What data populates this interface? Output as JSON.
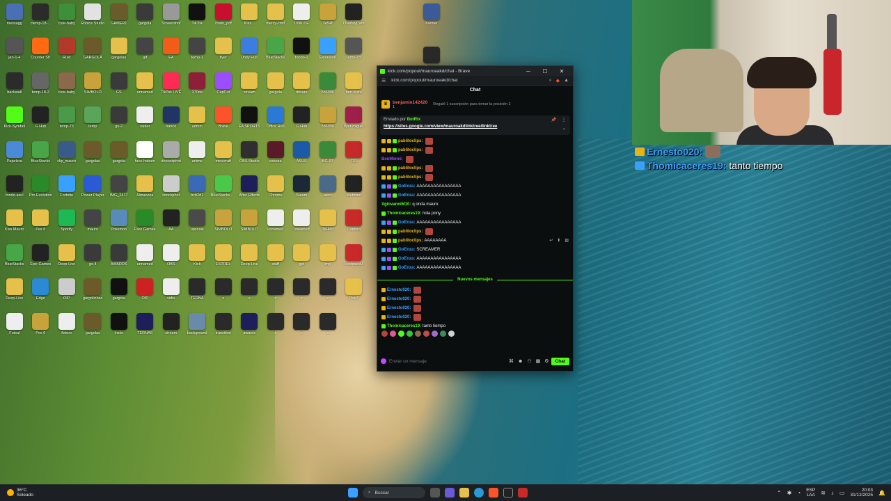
{
  "desktop": {
    "icons": [
      {
        "label": "messagg",
        "color": "#4a6fb5"
      },
      {
        "label": "ctemp-18-...",
        "color": "#2b2b2b"
      },
      {
        "label": "cute-baby",
        "color": "#3e8f3a"
      },
      {
        "label": "Roblox Studio",
        "color": "#e2e2e2"
      },
      {
        "label": "GAMER1",
        "color": "#6b5a2a"
      },
      {
        "label": "gargola",
        "color": "#3a3a3a"
      },
      {
        "label": "Screenshot",
        "color": "#999999"
      },
      {
        "label": "TikTok",
        "color": "#111111"
      },
      {
        "label": "chato_pdf",
        "color": "#c8102e"
      },
      {
        "label": "Kiss...",
        "color": "#e5c04a"
      },
      {
        "label": "mercy-cmd",
        "color": "#e5c04a"
      },
      {
        "label": "LINK DE",
        "color": "#eeeeee"
      },
      {
        "label": "2e54f",
        "color": "#c8a23a"
      },
      {
        "label": "OverlayCam",
        "color": "#222222"
      },
      {
        "label": "jan-1-4",
        "color": "#555555"
      },
      {
        "label": "Counter Str",
        "color": "#ff6a13"
      },
      {
        "label": "Rust",
        "color": "#b33a2a"
      },
      {
        "label": "GARGOLA",
        "color": "#6b5a2a"
      },
      {
        "label": "gargolas",
        "color": "#e5c04a"
      },
      {
        "label": "gif",
        "color": "#444444"
      },
      {
        "label": "EA",
        "color": "#f25c19"
      },
      {
        "label": "temp-1",
        "color": "#444444"
      },
      {
        "label": "flyer",
        "color": "#e5c04a"
      },
      {
        "label": "Unity Hub",
        "color": "#3b7de0"
      },
      {
        "label": "BlueStacks",
        "color": "#48a548"
      },
      {
        "label": "fondo-1",
        "color": "#111111"
      },
      {
        "label": "Extension",
        "color": "#3aa0ff"
      },
      {
        "label": "temp-18",
        "color": "#555555"
      },
      {
        "label": "backwall",
        "color": "#2b2b2b"
      },
      {
        "label": "temp-18-2",
        "color": "#666666"
      },
      {
        "label": "cute-baby",
        "color": "#8a6a4a"
      },
      {
        "label": "SIMBOLO",
        "color": "#c8a23a"
      },
      {
        "label": "GS",
        "color": "#3a3a3a"
      },
      {
        "label": "unnamed",
        "color": "#e5c04a"
      },
      {
        "label": "TikTok LIVE",
        "color": "#fe2c55"
      },
      {
        "label": "370da",
        "color": "#8e1f3a"
      },
      {
        "label": "CapCut",
        "color": "#9b4dff"
      },
      {
        "label": "stream",
        "color": "#e5c04a"
      },
      {
        "label": "gargola",
        "color": "#e5c04a"
      },
      {
        "label": "drivers",
        "color": "#e5c04a"
      },
      {
        "label": "5b6996",
        "color": "#3a8a3a"
      },
      {
        "label": "fam-textu",
        "color": "#e5c04a"
      },
      {
        "label": "Kick-Symbol",
        "color": "#53fc18"
      },
      {
        "label": "G Hub",
        "color": "#222222"
      },
      {
        "label": "temp-73",
        "color": "#4a9a4a"
      },
      {
        "label": "temp",
        "color": "#5aa55a"
      },
      {
        "label": "gs-2",
        "color": "#3a3a3a"
      },
      {
        "label": "raider",
        "color": "#eeeeee"
      },
      {
        "label": "banco",
        "color": "#223366"
      },
      {
        "label": "admin",
        "color": "#e5c04a"
      },
      {
        "label": "Brave",
        "color": "#fb542b"
      },
      {
        "label": "EA SPORTS",
        "color": "#111111"
      },
      {
        "label": "Office Hub",
        "color": "#2b79d6"
      },
      {
        "label": "G Hub",
        "color": "#222222"
      },
      {
        "label": "5b6996",
        "color": "#c8a23a"
      },
      {
        "label": "flyer-miguel",
        "color": "#9e1f4a"
      },
      {
        "label": "Papelera",
        "color": "#4a8ad6"
      },
      {
        "label": "BlueStacks",
        "color": "#48a548"
      },
      {
        "label": "clip_mauro",
        "color": "#3a5a8a"
      },
      {
        "label": "gargolas",
        "color": "#6b5a2a"
      },
      {
        "label": "gargola",
        "color": "#6b5a2a"
      },
      {
        "label": "face-hatsen",
        "color": "#ffffff"
      },
      {
        "label": "depositphot",
        "color": "#aaaaaa"
      },
      {
        "label": "anime",
        "color": "#eeeeee"
      },
      {
        "label": "minecraft",
        "color": "#e5c04a"
      },
      {
        "label": "OBS Studio",
        "color": "#302e31"
      },
      {
        "label": "cabeza",
        "color": "#5a1a2a"
      },
      {
        "label": "ASUS",
        "color": "#1a5aa6"
      },
      {
        "label": "BG-97",
        "color": "#3a8a3a"
      },
      {
        "label": "731",
        "color": "#c42a2a"
      },
      {
        "label": "fondo-azul",
        "color": "#222222"
      },
      {
        "label": "Pro Evolution",
        "color": "#2a8a2a"
      },
      {
        "label": "Fortnite",
        "color": "#3aa0ff"
      },
      {
        "label": "Power Player",
        "color": "#2b5ad6"
      },
      {
        "label": "IMG_2417",
        "color": "#444444"
      },
      {
        "label": "Almacena",
        "color": "#e5c04a"
      },
      {
        "label": "istockphot",
        "color": "#cccccc"
      },
      {
        "label": "bcb2d2",
        "color": "#3a6ab6"
      },
      {
        "label": "BlueStacks Multi",
        "color": "#4ac84a"
      },
      {
        "label": "After Effects",
        "color": "#1e1e5a"
      },
      {
        "label": "Chrome",
        "color": "#e5c04a"
      },
      {
        "label": "Steam",
        "color": "#1b2838"
      },
      {
        "label": "aiscr",
        "color": "#4a6a8a"
      },
      {
        "label": "Webcam",
        "color": "#222222"
      },
      {
        "label": "Kiss Mauro",
        "color": "#e5c04a"
      },
      {
        "label": "Pes 6",
        "color": "#e5c04a"
      },
      {
        "label": "Spotify",
        "color": "#1db954"
      },
      {
        "label": "mauro",
        "color": "#444444"
      },
      {
        "label": "Pokemon",
        "color": "#5a8aba"
      },
      {
        "label": "Free Games",
        "color": "#2a8a2a"
      },
      {
        "label": "AA",
        "color": "#222222"
      },
      {
        "label": "upscale",
        "color": "#4a4a4a"
      },
      {
        "label": "SIMBOLO",
        "color": "#c8a23a"
      },
      {
        "label": "SIMBOLO",
        "color": "#c8a23a"
      },
      {
        "label": "unnamed",
        "color": "#eeeeee"
      },
      {
        "label": "unnamed",
        "color": "#eeeeee"
      },
      {
        "label": "TeHicc",
        "color": "#e5c04a"
      },
      {
        "label": "Captura",
        "color": "#c82a2a"
      },
      {
        "label": "BlueStacks",
        "color": "#48a548"
      },
      {
        "label": "Epic Games",
        "color": "#222222"
      },
      {
        "label": "Deep-Live",
        "color": "#e5c04a"
      },
      {
        "label": "gs-4",
        "color": "#3a3a3a"
      },
      {
        "label": "AWARDS",
        "color": "#3a3a3a"
      },
      {
        "label": "unnamed",
        "color": "#eeeeee"
      },
      {
        "label": "OBS",
        "color": "#eeeeee"
      },
      {
        "label": "Kick",
        "color": "#e5c04a"
      },
      {
        "label": "ESTREL",
        "color": "#e5c04a"
      },
      {
        "label": "Deep-Live",
        "color": "#e5c04a"
      },
      {
        "label": "stuff",
        "color": "#e5c04a"
      },
      {
        "label": "gpt",
        "color": "#e5c04a"
      },
      {
        "label": "img",
        "color": "#e5c04a"
      },
      {
        "label": "ModpackM",
        "color": "#c82a2a"
      },
      {
        "label": "Deep-Live",
        "color": "#e5c04a"
      },
      {
        "label": "Edge",
        "color": "#2a8ad6"
      },
      {
        "label": "OIP",
        "color": "#cccccc"
      },
      {
        "label": "gargolinhas",
        "color": "#6b5a2a"
      },
      {
        "label": "gargola",
        "color": "#111111"
      },
      {
        "label": "OIP",
        "color": "#cc2222"
      },
      {
        "label": "vidio",
        "color": "#eeeeee"
      },
      {
        "label": "TERNA",
        "color": "#2a2a2a"
      },
      {
        "label": "x",
        "color": "#2a2a2a"
      },
      {
        "label": "x",
        "color": "#2a2a2a"
      },
      {
        "label": "x",
        "color": "#2a2a2a"
      },
      {
        "label": "x",
        "color": "#2a2a2a"
      },
      {
        "label": "x",
        "color": "#2a2a2a"
      },
      {
        "label": "Pes 6",
        "color": "#e5c04a"
      },
      {
        "label": "Futsal",
        "color": "#eeeeee"
      },
      {
        "label": "Pes 6",
        "color": "#c8a23a"
      },
      {
        "label": "fixture",
        "color": "#eeeeee"
      },
      {
        "label": "gargolas",
        "color": "#6b5a2a"
      },
      {
        "label": "Inicio",
        "color": "#111111"
      },
      {
        "label": "TERNAS",
        "color": "#1e1e5a"
      },
      {
        "label": "stream",
        "color": "#222222"
      },
      {
        "label": "background",
        "color": "#6a8aaa"
      },
      {
        "label": "transition",
        "color": "#2a2a2a"
      },
      {
        "label": "awards",
        "color": "#1e1e5a"
      },
      {
        "label": "x",
        "color": "#2a2a2a"
      },
      {
        "label": "x",
        "color": "#2a2a2a"
      },
      {
        "label": "x",
        "color": "#2a2a2a"
      }
    ],
    "extra_icons": [
      {
        "label": "banner",
        "color": "#3a5a9a"
      },
      {
        "label": "Spanish",
        "color": "#2a2a2a"
      }
    ]
  },
  "browser": {
    "window_title": "kick.com/popout/mauroeakd/chat - Brave",
    "url": "kick.com/popout/mauroeakd/chat",
    "buttons": {
      "minimize": "─",
      "maximize": "☐",
      "close": "✕"
    },
    "chat_header": "Chat",
    "sub_banner": {
      "user": "benjamin142420",
      "count": "1",
      "message": "Regaló 1 suscripción para tomar la posición 2"
    },
    "pinned": {
      "sent_by_label": "Enviado por",
      "sent_by_user": "BotRix",
      "link": "https://sites.google.com/view/mauroakdlinktree/linktree"
    },
    "messages": [
      {
        "badges": [
          "gold",
          "gold",
          "green"
        ],
        "user": "pablitoclips:",
        "user_color": "#e8b414",
        "text": "",
        "emote": true
      },
      {
        "badges": [
          "gold",
          "gold",
          "green"
        ],
        "user": "pablitoclips:",
        "user_color": "#e8b414",
        "text": "",
        "emote": true
      },
      {
        "badges": [],
        "user": "BenMimni:",
        "user_color": "#9b4dff",
        "text": "",
        "emote": true
      },
      {
        "badges": [
          "gold",
          "gold",
          "green"
        ],
        "user": "pablitoclips:",
        "user_color": "#e8b414",
        "text": "",
        "emote": true
      },
      {
        "badges": [
          "gold",
          "gold",
          "green"
        ],
        "user": "pablitoclips:",
        "user_color": "#e8b414",
        "text": "",
        "emote": true
      },
      {
        "badges": [
          "blue",
          "purple",
          "green"
        ],
        "user": "GoEnza:",
        "user_color": "#3aa0ff",
        "text": "AAAAAAAAAAAAAAAA",
        "emote": false
      },
      {
        "badges": [
          "blue",
          "purple",
          "green"
        ],
        "user": "GoEnza:",
        "user_color": "#3aa0ff",
        "text": "AAAAAAAAAAAAAAAA",
        "emote": false
      },
      {
        "badges": [],
        "user": "XgiovanniM10:",
        "user_color": "#53fc18",
        "text": "q onda mauro",
        "emote": false
      },
      {
        "badges": [
          "green"
        ],
        "user": "Thomicaceres19:",
        "user_color": "#53fc18",
        "text": "hola pony",
        "emote": false
      },
      {
        "badges": [
          "blue",
          "purple",
          "green"
        ],
        "user": "GoEnza:",
        "user_color": "#3aa0ff",
        "text": "AAAAAAAAAAAAAAAA",
        "emote": false
      },
      {
        "badges": [
          "gold",
          "gold",
          "green"
        ],
        "user": "pablitoclips:",
        "user_color": "#e8b414",
        "text": "",
        "emote": true
      },
      {
        "badges": [
          "gold",
          "gold",
          "green"
        ],
        "user": "pablitoclips:",
        "user_color": "#e8b414",
        "text": "AAAAAAAA",
        "emote": false,
        "tools": true
      },
      {
        "badges": [
          "blue",
          "purple",
          "green"
        ],
        "user": "GoEnza:",
        "user_color": "#3aa0ff",
        "text": "SCREAMER",
        "emote": false
      },
      {
        "badges": [
          "blue",
          "purple",
          "green"
        ],
        "user": "GoEnza:",
        "user_color": "#3aa0ff",
        "text": "AAAAAAAAAAAAAAAA",
        "emote": false
      },
      {
        "badges": [
          "blue",
          "purple",
          "green"
        ],
        "user": "GoEnza:",
        "user_color": "#3aa0ff",
        "text": "AAAAAAAAAAAAAAAA",
        "emote": false
      }
    ],
    "new_messages_label": "Nuevos mensajes",
    "new_messages": [
      {
        "badges": [
          "gold"
        ],
        "user": "Ernesto020:",
        "user_color": "#3aa0ff",
        "text": "",
        "emote": true
      },
      {
        "badges": [
          "gold"
        ],
        "user": "Ernesto020:",
        "user_color": "#3aa0ff",
        "text": "",
        "emote": true
      },
      {
        "badges": [
          "gold"
        ],
        "user": "Ernesto020:",
        "user_color": "#3aa0ff",
        "text": "",
        "emote": true
      },
      {
        "badges": [
          "gold"
        ],
        "user": "Ernesto020:",
        "user_color": "#3aa0ff",
        "text": "",
        "emote": true
      },
      {
        "badges": [
          "green"
        ],
        "user": "Thomicaceres19:",
        "user_color": "#53fc18",
        "text": "tanto tiempo",
        "emote": false
      }
    ],
    "input_placeholder": "Enviar un mensaje",
    "send_label": "Chat",
    "accent": "#53fc18"
  },
  "overlay_chat": [
    {
      "user": "Ernesto020:",
      "text": ""
    },
    {
      "user": "Thomicaceres19:",
      "text": "tanto tiempo"
    }
  ],
  "taskbar": {
    "weather_temp": "36°C",
    "weather_desc": "Soleado",
    "search_label": "Buscar",
    "lang_top": "ESP",
    "lang_bottom": "LAA",
    "time": "20:03",
    "date": "31/12/2025"
  }
}
